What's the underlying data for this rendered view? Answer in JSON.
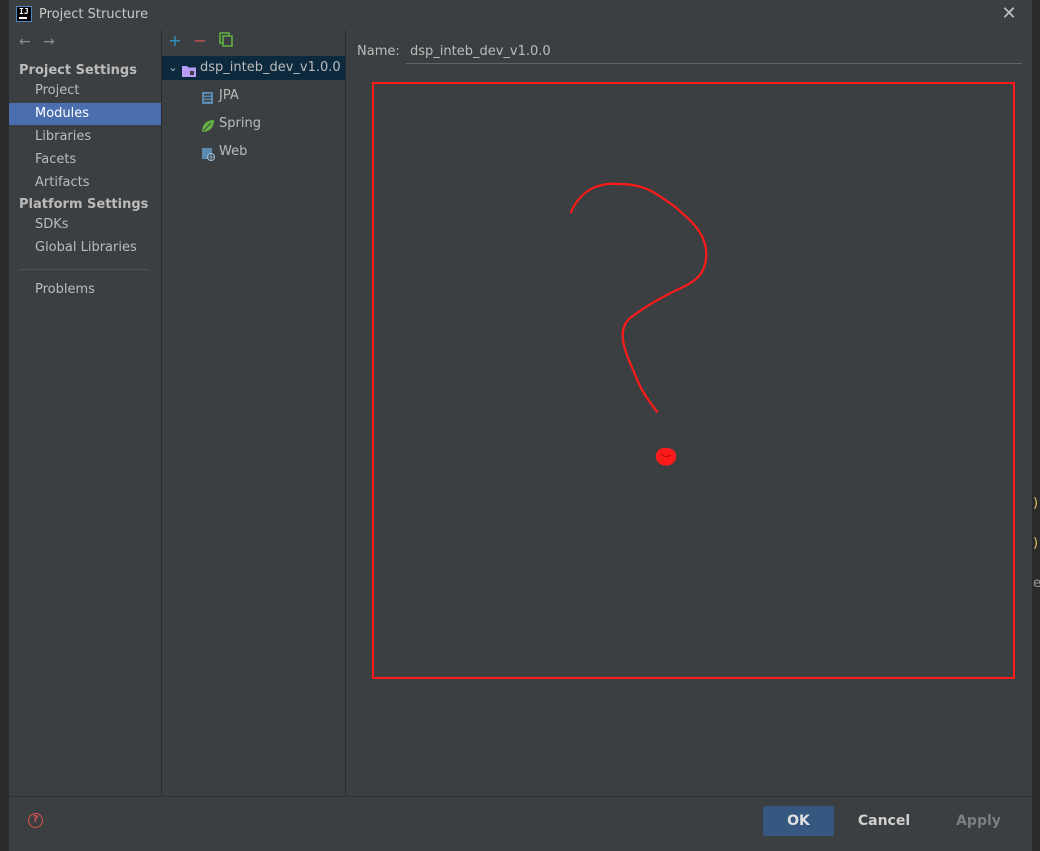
{
  "window": {
    "title": "Project Structure"
  },
  "nav": {
    "project_settings_title": "Project Settings",
    "project_settings_items": [
      {
        "label": "Project"
      },
      {
        "label": "Modules",
        "selected": true
      },
      {
        "label": "Libraries"
      },
      {
        "label": "Facets"
      },
      {
        "label": "Artifacts"
      }
    ],
    "platform_settings_title": "Platform Settings",
    "platform_settings_items": [
      {
        "label": "SDKs"
      },
      {
        "label": "Global Libraries"
      }
    ],
    "problems_label": "Problems"
  },
  "tree": {
    "root": {
      "label": "dsp_inteb_dev_v1.0.0",
      "icon": "module-folder-icon"
    },
    "children": [
      {
        "label": "JPA",
        "icon": "jpa-icon"
      },
      {
        "label": "Spring",
        "icon": "spring-leaf-icon"
      },
      {
        "label": "Web",
        "icon": "web-icon"
      }
    ]
  },
  "main": {
    "name_label": "Name:",
    "name_value": "dsp_inteb_dev_v1.0.0",
    "annotation": {
      "color": "#ff1a1a",
      "symbol": "question-mark-drawing"
    }
  },
  "footer": {
    "ok_label": "OK",
    "cancel_label": "Cancel",
    "apply_label": "Apply"
  },
  "colors": {
    "background": "#3c3f41",
    "selection": "#4b6eaf",
    "tree_selection": "#0d293e",
    "ok_button": "#365880",
    "add_icon": "#3592c4",
    "remove_icon": "#c75450",
    "copy_icon": "#62b543",
    "annotation": "#ff1a1a"
  }
}
